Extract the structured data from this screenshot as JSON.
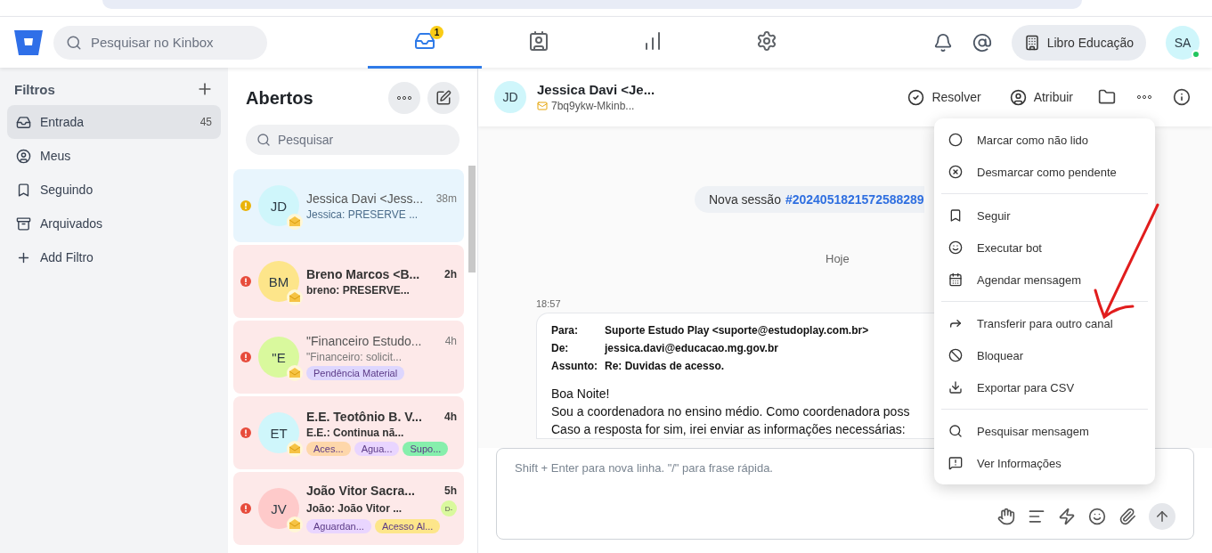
{
  "topbar": {
    "search": {
      "placeholder": "Pesquisar no Kinbox"
    },
    "nav_tabs": [
      {
        "selected": true,
        "badge": "1"
      },
      {
        "selected": false
      },
      {
        "selected": false
      },
      {
        "selected": false
      }
    ],
    "workspace": "Libro Educação",
    "user": {
      "initials": "SA",
      "online": true
    }
  },
  "sidebar": {
    "title": "Filtros",
    "items": [
      {
        "label": "Entrada",
        "count": "45",
        "selected": true
      },
      {
        "label": "Meus",
        "selected": false
      },
      {
        "label": "Seguindo",
        "selected": false
      },
      {
        "label": "Arquivados",
        "selected": false
      },
      {
        "label": "Add Filtro",
        "selected": false
      }
    ]
  },
  "conversation_list": {
    "title": "Abertos",
    "search": {
      "placeholder": "Pesquisar"
    },
    "items": [
      {
        "name": "Jessica Davi <Jess...",
        "preview": "Jessica: PRESERVE ...",
        "time": "38m",
        "initials": "JD",
        "color": "#cff6fb",
        "kind": "warning",
        "unread": false,
        "selected": true
      },
      {
        "name": "Breno Marcos <B...",
        "preview": "breno: PRESERVE...",
        "time": "2h",
        "initials": "BM",
        "color": "#fde58a",
        "kind": "urgent",
        "unread": true,
        "selected": false
      },
      {
        "name": "\"Financeiro Estudo...",
        "preview": "\"Financeiro: solicit...",
        "time": "4h",
        "initials": "\"E",
        "color": "#d9f99d",
        "kind": "urgent",
        "unread": false,
        "selected": false,
        "tags": [
          {
            "label": "Pendência Material",
            "color": "#ddd6fe"
          }
        ]
      },
      {
        "name": "E.E. Teotônio B. V...",
        "preview": "E.E.: Continua nã...",
        "time": "4h",
        "initials": "ET",
        "color": "#cff6fb",
        "kind": "urgent",
        "unread": true,
        "selected": false,
        "tags": [
          {
            "label": "Aces...",
            "color": "#fed7aa"
          },
          {
            "label": "Agua...",
            "color": "#e9d5ff"
          },
          {
            "label": "Supo...",
            "color": "#86efac"
          }
        ]
      },
      {
        "name": "João Vitor Sacra...",
        "preview": "João: João Vitor ...",
        "time": "5h",
        "initials": "JV",
        "color": "#fecaca",
        "kind": "urgent",
        "unread": true,
        "selected": false,
        "agent": "D-",
        "tags": [
          {
            "label": "Aguardan...",
            "color": "#e9d5ff"
          },
          {
            "label": "Acesso Al...",
            "color": "#fde68a"
          }
        ]
      }
    ]
  },
  "chat": {
    "contact": {
      "initials": "JD",
      "name": "Jessica Davi <Je...",
      "channel": "7bq9ykw-Mkinb..."
    },
    "actions": [
      "Resolver",
      "Atribuir"
    ],
    "session": {
      "text": "Nova sessão",
      "id": "#2024051821572588289"
    },
    "day": "Hoje",
    "message": {
      "time": "18:57",
      "headers": [
        {
          "label": "Para:",
          "value": "Suporte Estudo Play <suporte@estudoplay.com.br>"
        },
        {
          "label": "De:",
          "value": "jessica.davi@educacao.mg.gov.br"
        },
        {
          "label": "Assunto:",
          "value": "Re: Duvidas de acesso."
        }
      ],
      "body": [
        "Boa Noite!",
        "Sou a coordenadora no ensino médio. Como coordenadora poss",
        "Caso a resposta for sim, irei enviar as informações necessárias:"
      ]
    },
    "composer": {
      "placeholder": "Shift + Enter para nova linha. \"/\" para frase rápida."
    }
  },
  "menu": {
    "groups": [
      [
        "Marcar como não lido",
        "Desmarcar como pendente"
      ],
      [
        "Seguir",
        "Executar bot",
        "Agendar mensagem"
      ],
      [
        "Transferir para outro canal",
        "Bloquear",
        "Exportar para CSV"
      ],
      [
        "Pesquisar mensagem",
        "Ver Informações"
      ]
    ]
  }
}
